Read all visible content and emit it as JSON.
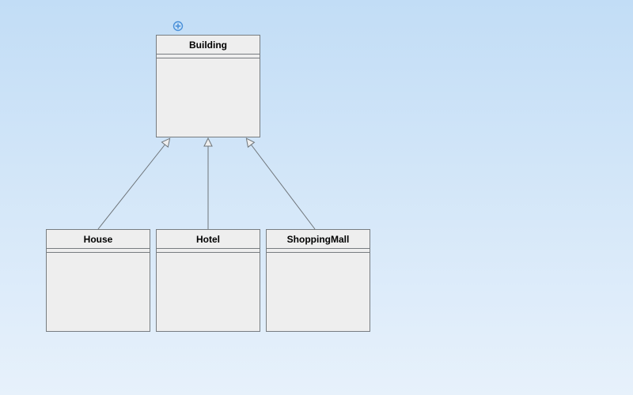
{
  "classes": {
    "parent": {
      "name": "Building"
    },
    "children": [
      {
        "name": "House"
      },
      {
        "name": "Hotel"
      },
      {
        "name": "ShoppingMall"
      }
    ]
  },
  "icons": {
    "add": "add-icon"
  },
  "colors": {
    "node_fill": "#eeeeee",
    "node_border": "#777c80",
    "edge": "#6e7479",
    "accent": "#4a90d9"
  }
}
